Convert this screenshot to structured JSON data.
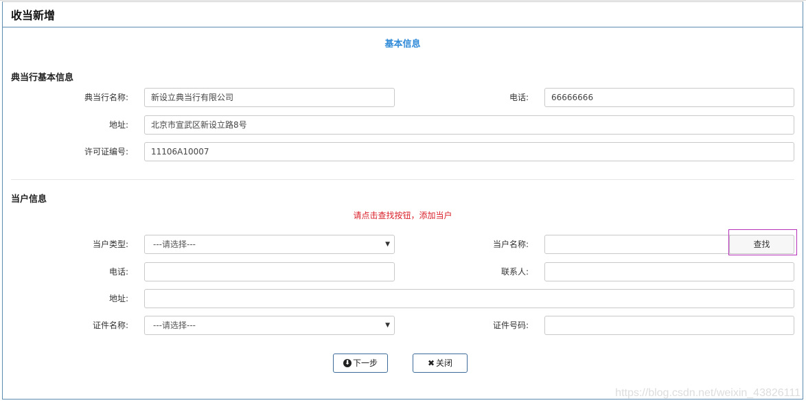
{
  "page": {
    "title": "收当新增",
    "tab": "基本信息"
  },
  "shop": {
    "heading": "典当行基本信息",
    "name_label": "典当行名称:",
    "name_value": "新设立典当行有限公司",
    "phone_label": "电话:",
    "phone_value": "66666666",
    "address_label": "地址:",
    "address_value": "北京市宣武区新设立路8号",
    "license_label": "许可证编号:",
    "license_value": "11106A10007"
  },
  "customer": {
    "heading": "当户信息",
    "hint": "请点击查找按钮，添加当户",
    "type_label": "当户类型:",
    "type_value": "---请选择---",
    "name_label": "当户名称:",
    "name_value": "",
    "find_label": "查找",
    "phone_label": "电话:",
    "phone_value": "",
    "contact_label": "联系人:",
    "contact_value": "",
    "address_label": "地址:",
    "address_value": "",
    "cert_name_label": "证件名称:",
    "cert_name_value": "---请选择---",
    "cert_no_label": "证件号码:",
    "cert_no_value": ""
  },
  "actions": {
    "next_label": "下一步",
    "close_label": "关闭",
    "next_icon": "circle-arrow-down-icon",
    "close_icon": "close-icon"
  },
  "watermark": "https://blog.csdn.net/weixin_43826111",
  "colors": {
    "accent": "#2f8ad8",
    "hint": "#d9202a",
    "highlight": "#b32fb8"
  }
}
